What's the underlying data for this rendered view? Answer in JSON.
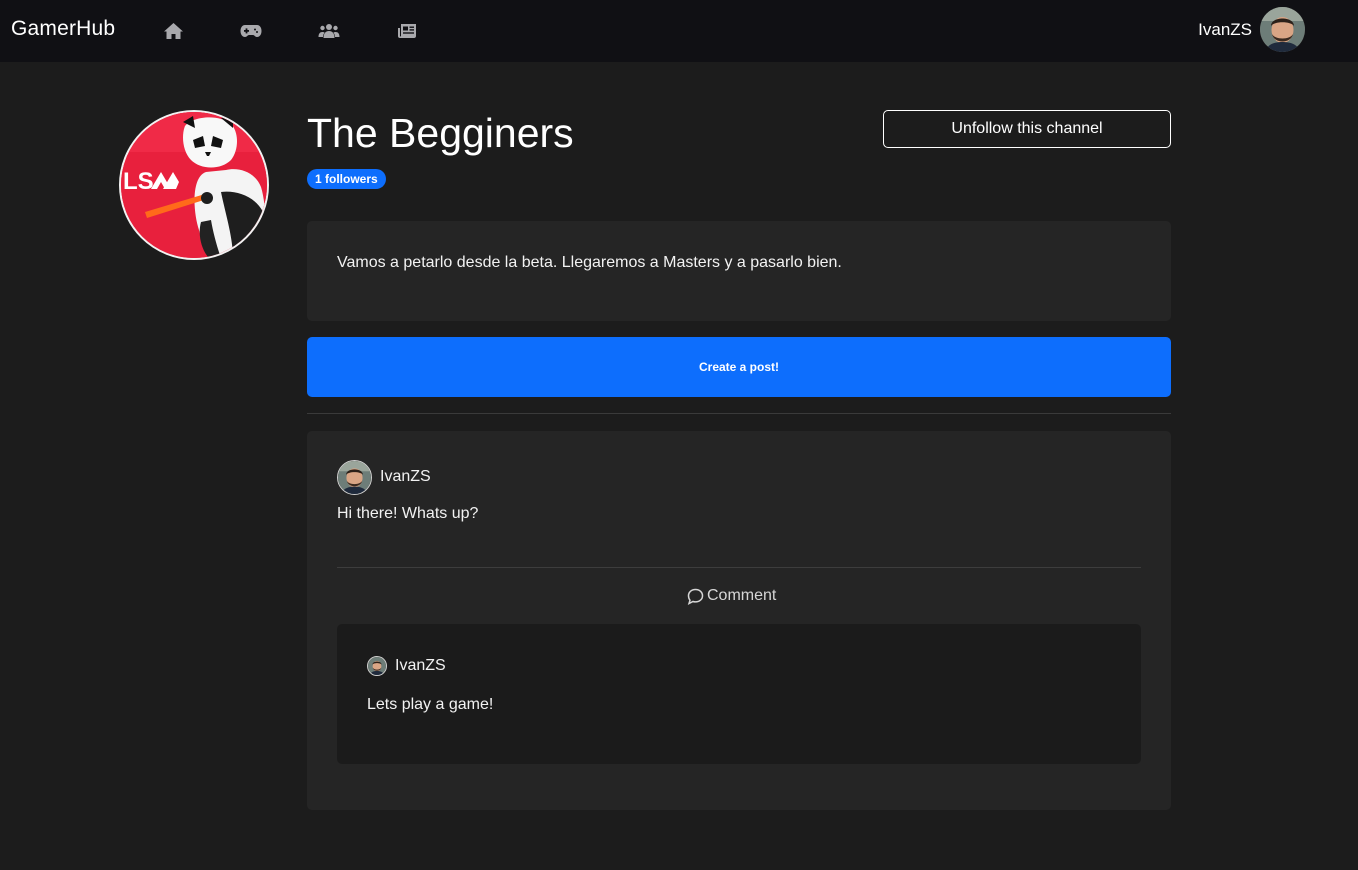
{
  "navbar": {
    "brand": "GamerHub",
    "icons": [
      "home-icon",
      "gamepad-icon",
      "users-icon",
      "newspaper-icon"
    ],
    "user_name": "IvanZS"
  },
  "channel": {
    "title": "The Begginers",
    "followers_badge": "1 followers",
    "unfollow_label": "Unfollow this channel",
    "description": "Vamos a petarlo desde la beta. Llegaremos a Masters y a pasarlo bien.",
    "create_post_label": "Create a post!",
    "avatar_logo_text": "LS"
  },
  "post": {
    "author": "IvanZS",
    "body": "Hi there! Whats up?",
    "comment_label": "Comment",
    "comments": [
      {
        "author": "IvanZS",
        "body": "Lets play a game!"
      }
    ]
  },
  "colors": {
    "navbar_bg": "#101014",
    "page_bg": "#1c1c1c",
    "card_bg": "#252525",
    "comment_bg": "#1b1b1b",
    "accent": "#0d6efd",
    "channel_avatar_bg": "#e8203d"
  }
}
